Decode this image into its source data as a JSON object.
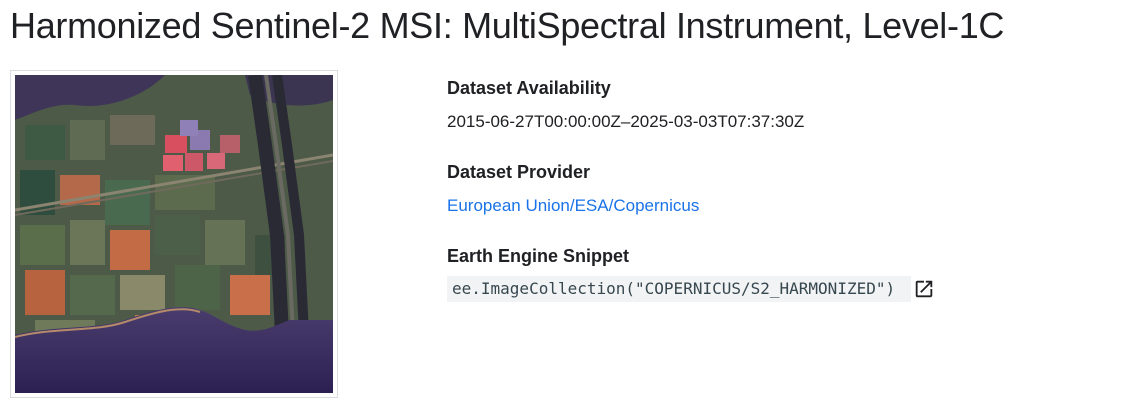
{
  "page": {
    "title": "Harmonized Sentinel-2 MSI: MultiSpectral Instrument, Level-1C"
  },
  "thumbnail": {
    "icon": "satellite-image-thumbnail"
  },
  "availability": {
    "heading": "Dataset Availability",
    "value": "2015-06-27T00:00:00Z–2025-03-03T07:37:30Z"
  },
  "provider": {
    "heading": "Dataset Provider",
    "link_text": "European Union/ESA/Copernicus"
  },
  "snippet": {
    "heading": "Earth Engine Snippet",
    "code": "ee.ImageCollection(\"COPERNICUS/S2_HARMONIZED\")",
    "open_icon": "open-in-new-icon"
  },
  "colors": {
    "link": "#1a73e8",
    "code_bg": "#f1f3f4",
    "text": "#202124"
  }
}
